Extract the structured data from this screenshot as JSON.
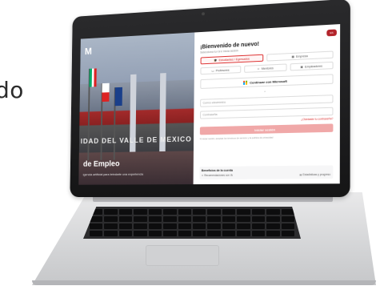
{
  "background": {
    "partial_text": "do"
  },
  "left_panel": {
    "logo_text": "M",
    "banner_text": "IDAD DEL VALLE DE MEXICO",
    "hero_title": "de Empleo",
    "hero_subtitle": "igencia artificial para brindarte una experiencia"
  },
  "form": {
    "corner_badge": "ES",
    "welcome_title": "¡Bienvenido de nuevo!",
    "welcome_subtitle": "Selecciona tu rol e inicia sesión",
    "roles": [
      {
        "label": "Estudiantes / Egresados",
        "icon": "graduation-cap-icon",
        "active": true
      },
      {
        "label": "Empresa",
        "icon": "building-icon",
        "active": false
      },
      {
        "label": "Profesores",
        "icon": "chalkboard-icon",
        "active": false
      },
      {
        "label": "Mentores",
        "icon": "users-icon",
        "active": false
      },
      {
        "label": "Empleadores",
        "icon": "briefcase-icon",
        "active": false
      }
    ],
    "microsoft_button": "Continuar con Microsoft",
    "divider": "o",
    "email_placeholder": "Correo electrónico",
    "password_placeholder": "Contraseña",
    "forgot_password": "¿Olvidaste tu contraseña?",
    "submit_label": "Iniciar sesión",
    "terms_text": "Al iniciar sesión, aceptas los términos de servicio y la política de privacidad",
    "benefits_title": "Beneficios de la cuenta",
    "benefits": [
      {
        "label": "Recomendaciones con IA"
      },
      {
        "label": "Estadísticas y progreso"
      }
    ]
  },
  "colors": {
    "accent": "#d33333",
    "brand_dark": "#b3242b"
  }
}
